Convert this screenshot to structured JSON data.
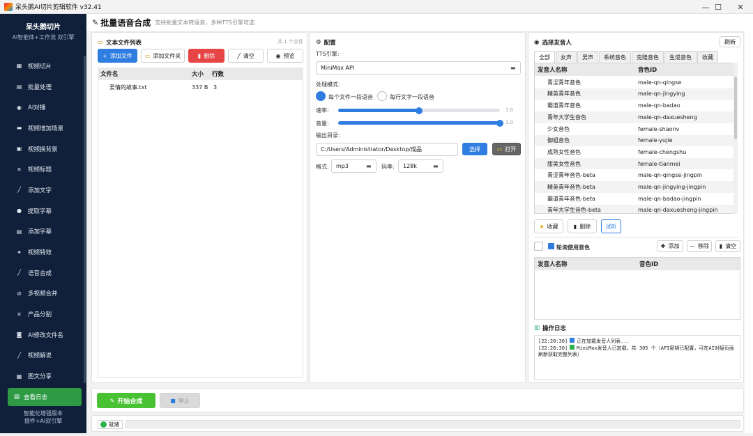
{
  "window": {
    "title": "呆头鹅AI切片剪辑软件 v32.41",
    "minimize": "—",
    "maximize": "☐",
    "close": "✕"
  },
  "sidebar": {
    "brand_name": "呆头鹅切片",
    "brand_sub": "AI智能体+工作流 双引擎",
    "items": [
      {
        "label": "视频切片",
        "icon": "▦"
      },
      {
        "label": "批量处理",
        "icon": "▤"
      },
      {
        "label": "AI对播",
        "icon": "◉"
      },
      {
        "label": "视频增加场景",
        "icon": "▬"
      },
      {
        "label": "视频换背景",
        "icon": "▣"
      },
      {
        "label": "视频标题",
        "icon": "✕"
      },
      {
        "label": "添加文字",
        "icon": "╱"
      },
      {
        "label": "提取字幕",
        "icon": "●"
      },
      {
        "label": "添加字幕",
        "icon": "▤"
      },
      {
        "label": "视频特效",
        "icon": "✦"
      },
      {
        "label": "语音合成",
        "icon": "╱"
      },
      {
        "label": "多视频合并",
        "icon": "⊘"
      },
      {
        "label": "产品分割",
        "icon": "✕"
      },
      {
        "label": "AI修改文件名",
        "icon": "◙"
      },
      {
        "label": "视频解说",
        "icon": "╱"
      },
      {
        "label": "图文分享",
        "icon": "▦"
      }
    ],
    "log_button": "查看日志",
    "log_icon": "▤",
    "footer_line1": "智能化增强版本",
    "footer_line2": "插件+AI双引擎"
  },
  "header": {
    "icon": "✎",
    "title": "批量语音合成",
    "subtitle": "支持批量文本转语音，多种TTS引擎可选"
  },
  "files": {
    "icon": "▭",
    "title": "文本文件列表",
    "count": "共 1 个文件",
    "buttons": {
      "add_file": "添加文件",
      "add_folder": "添加文件夹",
      "delete": "删除",
      "clear": "清空",
      "preview": "预览"
    },
    "columns": [
      "文件名",
      "大小",
      "行数"
    ],
    "rows": [
      {
        "name": "爱情的故事.txt",
        "size": "337 B",
        "lines": "3"
      }
    ]
  },
  "config": {
    "icon": "⚙",
    "title": "配置",
    "tts_label": "TTS引擎:",
    "tts_value": "MiniMax API",
    "mode_label": "处理模式:",
    "mode_option1": "每个文件一段语音",
    "mode_option2": "每行文字一段语音",
    "speed_label": "速率:",
    "speed_value": "1.0",
    "speed_level": 0.5,
    "volume_label": "音量:",
    "volume_value": "1.0",
    "volume_level": 1.0,
    "output_label": "输出目录:",
    "output_value": "C:/Users/Administrator/Desktop/成品",
    "choose_button": "选择",
    "open_button": "打开",
    "format_label": "格式:",
    "format_value": "mp3",
    "bitrate_label": "码率:",
    "bitrate_value": "128k"
  },
  "speakers": {
    "icon": "◉",
    "title": "选择发音人",
    "refresh": "刷新",
    "tabs": [
      "全部",
      "女声",
      "男声",
      "系统音色",
      "克隆音色",
      "生成音色",
      "收藏"
    ],
    "columns": [
      "发音人名称",
      "音色ID"
    ],
    "rows": [
      {
        "name": "青涩青年音色",
        "id": "male-qn-qingse"
      },
      {
        "name": "精英青年音色",
        "id": "male-qn-jingying"
      },
      {
        "name": "霸道青年音色",
        "id": "male-qn-badao"
      },
      {
        "name": "青年大学生音色",
        "id": "male-qn-daxuesheng"
      },
      {
        "name": "少女音色",
        "id": "female-shaonv"
      },
      {
        "name": "御姐音色",
        "id": "female-yujie"
      },
      {
        "name": "成熟女性音色",
        "id": "female-chengshu"
      },
      {
        "name": "甜美女性音色",
        "id": "female-tianmei"
      },
      {
        "name": "青涩青年音色-beta",
        "id": "male-qn-qingse-jingpin"
      },
      {
        "name": "精英青年音色-beta",
        "id": "male-qn-jingying-jingpin"
      },
      {
        "name": "霸道青年音色-beta",
        "id": "male-qn-badao-jingpin"
      },
      {
        "name": "青年大学生音色-beta",
        "id": "male-qn-daxuesheng-jingpin"
      }
    ],
    "fav_button": "收藏",
    "delete_button": "删除",
    "listen_button": "试听"
  },
  "rotation": {
    "label": "轮询使用音色",
    "add": "添加",
    "remove": "移除",
    "clear": "清空",
    "columns": [
      "发音人名称",
      "音色ID"
    ]
  },
  "log": {
    "icon": "▥",
    "title": "操作日志",
    "lines": [
      {
        "time": "[22:28:30]",
        "text": "正在加载发音人列表..."
      },
      {
        "time": "[22:28:30]",
        "text": "MiniMax发音人已加载，共 305 个（API密钥已配置，可在AI对接页面"
      },
      {
        "time": "",
        "text": "刷新获取完整列表）"
      }
    ]
  },
  "actions": {
    "start": "开始合成",
    "stop": "停止"
  },
  "status": {
    "text": "就绪",
    "progress": 0
  },
  "colors": {
    "sidebar": "#10203a",
    "accent": "#2f7de1",
    "green": "#2e9a44",
    "red": "#e64545"
  }
}
